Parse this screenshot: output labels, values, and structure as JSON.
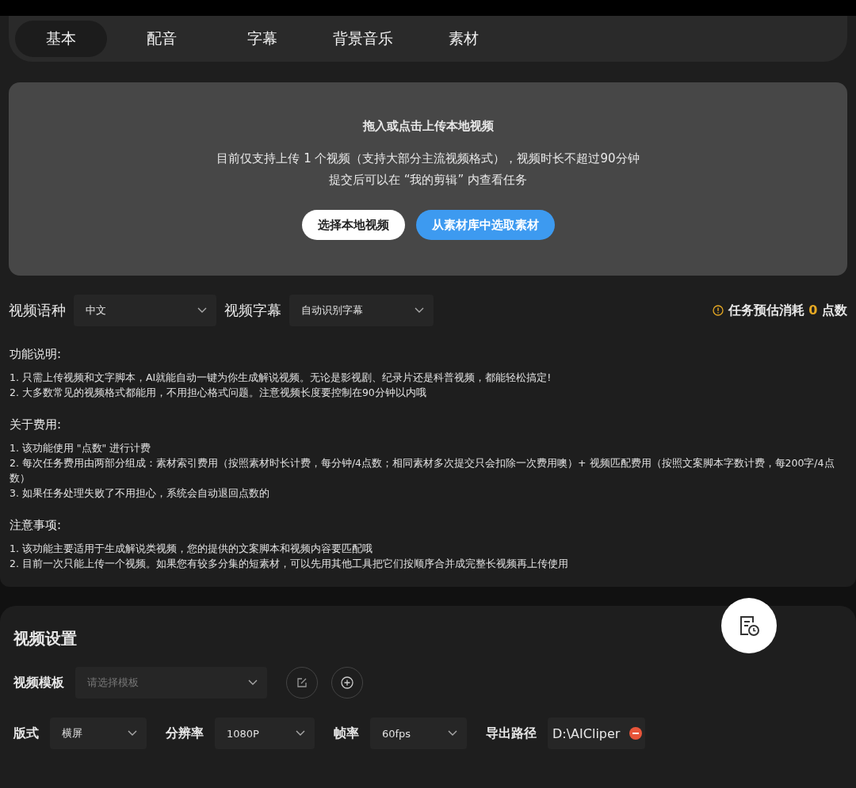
{
  "tabs": [
    {
      "label": "基本",
      "selected": true
    },
    {
      "label": "配音",
      "selected": false
    },
    {
      "label": "字幕",
      "selected": false
    },
    {
      "label": "背景音乐",
      "selected": false
    },
    {
      "label": "素材",
      "selected": false
    }
  ],
  "upload": {
    "title": "拖入或点击上传本地视频",
    "lines": [
      "目前仅支持上传 1 个视频（支持大部分主流视频格式），视频时长不超过90分钟",
      "提交后可以在 “我的剪辑” 内查看任务"
    ],
    "buttons": [
      {
        "label": "选择本地视频",
        "kind": "secondary"
      },
      {
        "label": "从素材库中选取素材",
        "kind": "primary"
      }
    ]
  },
  "options": [
    {
      "label": "视频语种",
      "value": "中文"
    },
    {
      "label": "视频字幕",
      "value": "自动识别字幕"
    }
  ],
  "cost": {
    "prefix": "任务预估消耗",
    "amount": "0",
    "suffix": "点数"
  },
  "notes": [
    {
      "heading": "功能说明:",
      "lines": [
        "1. 只需上传视频和文字脚本，AI就能自动一键为你生成解说视频。无论是影视剧、纪录片还是科普视频，都能轻松搞定!",
        "2. 大多数常见的视频格式都能用，不用担心格式问题。注意视频长度要控制在90分钟以内哦"
      ]
    },
    {
      "heading": "关于费用:",
      "lines": [
        "1. 该功能使用 \"点数\" 进行计费",
        "2. 每次任务费用由两部分组成：素材索引费用（按照素材时长计费，每分钟/4点数；相同素材多次提交只会扣除一次费用噢）+ 视频匹配费用（按照文案脚本字数计费，每200字/4点数）",
        "3. 如果任务处理失败了不用担心，系统会自动退回点数的"
      ]
    },
    {
      "heading": "注意事项:",
      "lines": [
        "1. 该功能主要适用于生成解说类视频，您的提供的文案脚本和视频内容要匹配哦",
        "2. 目前一次只能上传一个视频。如果您有较多分集的短素材，可以先用其他工具把它们按顺序合并成完整长视频再上传使用"
      ]
    }
  ],
  "video_settings": {
    "title": "视频设置",
    "template": {
      "label": "视频模板",
      "placeholder": "请选择模板"
    },
    "fields": [
      {
        "label": "版式",
        "value": "横屏",
        "kind": "select"
      },
      {
        "label": "分辨率",
        "value": "1080P",
        "kind": "select"
      },
      {
        "label": "帧率",
        "value": "60fps",
        "kind": "select"
      },
      {
        "label": "导出路径",
        "value": "D:\\AICliper",
        "kind": "path"
      }
    ]
  }
}
